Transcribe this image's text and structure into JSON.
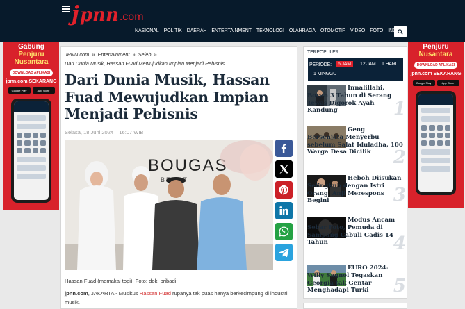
{
  "header": {
    "logo": {
      "j": "j",
      "pnn": "pnn",
      "com": ".com"
    },
    "nav": [
      "Nasional",
      "Politik",
      "Daerah",
      "Entertainment",
      "Teknologi",
      "Olahraga",
      "Otomotif",
      "Video",
      "Foto",
      "Indeks"
    ]
  },
  "ads": {
    "left": {
      "head": "Gabung",
      "sub": "Penjuru Nusantara",
      "download": "DOWNLOAD APLIKASI",
      "site": "jpnn.com SEKARANG",
      "store1": "Google Play",
      "store2": "App Store"
    },
    "right": {
      "head": "Penjuru",
      "sub": "Nusantara",
      "download": "DOWNLOAD APLIKASI",
      "site": "jpnn.com SEKARANG",
      "store1": "Google Play",
      "store2": "App Store"
    }
  },
  "article": {
    "breadcrumbs": [
      "JPNN.com",
      "Entertainment",
      "Seleb",
      "Dari Dunia Musik, Hassan Fuad Mewujudkan Impian Menjadi Pebisnis"
    ],
    "title": "Dari Dunia Musik, Hassan Fuad Mewujudkan Impian Menjadi Pebisnis",
    "date": "Selasa, 18 Juni 2024 – 16:07 WIB",
    "photo_sign": "BOUGAS",
    "photo_sign2": "BEAUT",
    "caption": "Hassan Fuad (memakai topi). Foto: dok. pribadi",
    "body": {
      "source": "jpnn.com",
      "lead": ", JAKARTA - Musikus ",
      "link": "Hassan Fuad",
      "rest": " rupanya tak puas hanya berkecimpung di industri musik."
    }
  },
  "share": [
    {
      "name": "facebook",
      "color": "#3b5998"
    },
    {
      "name": "x",
      "color": "#000000"
    },
    {
      "name": "pinterest",
      "color": "#cb2027"
    },
    {
      "name": "linkedin",
      "color": "#0e76a8"
    },
    {
      "name": "whatsapp",
      "color": "#25a244"
    },
    {
      "name": "telegram",
      "color": "#2aa3de"
    }
  ],
  "popular": {
    "heading": "Terpopuler",
    "period_label": "Periode:",
    "periods": [
      "6 Jam",
      "12 Jam",
      "1 Hari",
      "1 Minggu"
    ],
    "active_period": "6 Jam",
    "items": [
      {
        "rank": "1",
        "title": "Innalillahi, Bocah 3 Tahun di Serang Tewas Digorok Ayah Kandung"
      },
      {
        "rank": "2",
        "title": "Geng Bersenjata Menyerbu sebelum Salat Iduladha, 100 Warga Desa Dicilik"
      },
      {
        "rank": "3",
        "title": "Heboh Diisukan Selingkuh dengan Istri Orang, Anji Merespons Begini"
      },
      {
        "rank": "4",
        "title": "Modus Ancam Sebar Foto, Pemuda di Sampang Cabuli Gadis 14 Tahun"
      },
      {
        "rank": "5",
        "title": "EURO 2024: Willy Sagnol Tegaskan Georgia tak Gentar Menghadapi Turki"
      }
    ]
  }
}
